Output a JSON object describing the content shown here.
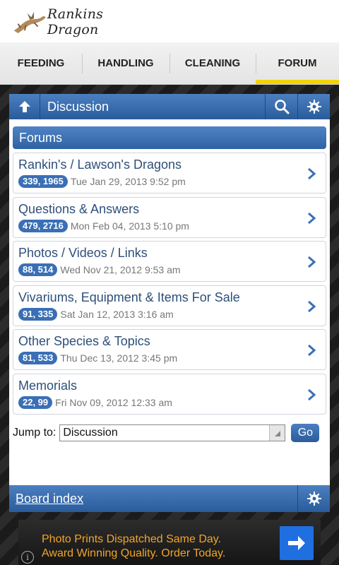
{
  "header": {
    "logo_text": "Rankins Dragon"
  },
  "tabs": [
    {
      "label": "FEEDING"
    },
    {
      "label": "HANDLING"
    },
    {
      "label": "CLEANING"
    },
    {
      "label": "FORUM"
    }
  ],
  "topbar": {
    "title": "Discussion"
  },
  "section": {
    "title": "Forums"
  },
  "forums": [
    {
      "name": "Rankin's / Lawson's Dragons",
      "counts": "339, 1965",
      "date": "Tue Jan 29, 2013 9:52 pm"
    },
    {
      "name": "Questions & Answers",
      "counts": "479, 2716",
      "date": "Mon Feb 04, 2013 5:10 pm"
    },
    {
      "name": "Photos / Videos / Links",
      "counts": "88, 514",
      "date": "Wed Nov 21, 2012 9:53 am"
    },
    {
      "name": "Vivariums, Equipment & Items For Sale",
      "counts": "91, 335",
      "date": "Sat Jan 12, 2013 3:16 am"
    },
    {
      "name": "Other Species & Topics",
      "counts": "81, 533",
      "date": "Thu Dec 13, 2012 3:45 pm"
    },
    {
      "name": "Memorials",
      "counts": "22, 99",
      "date": "Fri Nov 09, 2012 12:33 am"
    }
  ],
  "jump": {
    "label": "Jump to:",
    "selected": "Discussion",
    "button": "Go"
  },
  "footer": {
    "board_index": "Board index"
  },
  "ad": {
    "line1": "Photo Prints Dispatched Same Day.",
    "line2": "Award Winning Quality. Order Today.",
    "info": "i"
  },
  "colors": {
    "accent": "#2f62a2",
    "tab_indicator": "#f3d400",
    "ad_text": "#f0a52a",
    "ad_button": "#1f6fe0"
  }
}
